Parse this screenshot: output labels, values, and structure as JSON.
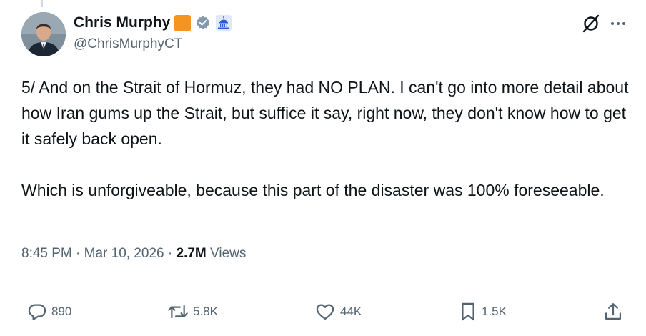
{
  "author": {
    "display_name": "Chris Murphy",
    "handle": "@ChrisMurphyCT",
    "org_badge_color": "#f7941d",
    "verified_badge_color": "#829aab",
    "affiliation_icon": "capitol-building-icon"
  },
  "tweet": {
    "paragraphs": [
      "5/ And on the Strait of Hormuz, they had NO PLAN. I can't go into more detail about how Iran gums up the Strait, but suffice it say, right now, they don't know how to get it safely back open.",
      "Which is unforgiveable, because this part of the disaster was 100% foreseeable."
    ],
    "time": "8:45 PM",
    "date": "Mar 10, 2026",
    "separator": "·",
    "views_count": "2.7M",
    "views_label": "Views"
  },
  "actions": {
    "replies": "890",
    "reposts": "5.8K",
    "likes": "44K",
    "bookmarks": "1.5K"
  },
  "icons": {
    "header": [
      "grok-icon",
      "more-icon"
    ],
    "actions": [
      "reply-icon",
      "repost-icon",
      "like-icon",
      "bookmark-icon",
      "share-icon"
    ]
  },
  "colors": {
    "text_primary": "#0f1419",
    "text_secondary": "#536471",
    "divider": "#eff3f4"
  }
}
